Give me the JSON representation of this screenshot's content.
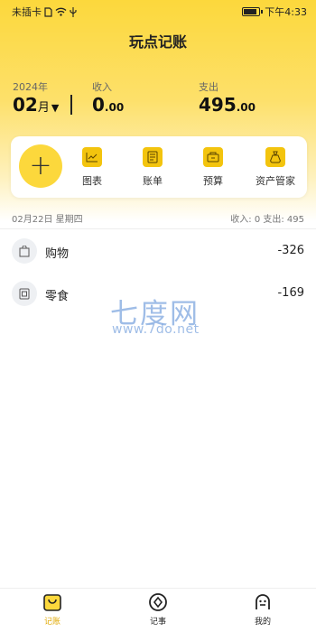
{
  "status_bar": {
    "carrier": "未插卡",
    "time": "下午4:33"
  },
  "app": {
    "title": "玩点记账"
  },
  "summary": {
    "year_label": "2024年",
    "month_num": "02",
    "month_suffix": "月",
    "income_label": "收入",
    "income_int": "0",
    "income_dec": ".00",
    "expense_label": "支出",
    "expense_int": "495",
    "expense_dec": ".00"
  },
  "actions": {
    "add_symbol": "+",
    "items": [
      {
        "label": "图表",
        "icon": "chart-icon"
      },
      {
        "label": "账单",
        "icon": "bill-icon"
      },
      {
        "label": "预算",
        "icon": "budget-icon"
      },
      {
        "label": "资产管家",
        "icon": "wallet-icon"
      }
    ]
  },
  "day": {
    "date": "02月22日 星期四",
    "totals": "收入:  0   支出:  495"
  },
  "records": [
    {
      "name": "购物",
      "amount": "-326",
      "icon": "shopping-bag-icon"
    },
    {
      "name": "零食",
      "amount": "-169",
      "icon": "snack-icon"
    }
  ],
  "watermark": {
    "line1": "七度网",
    "line2": "www.7do.net"
  },
  "nav": {
    "items": [
      {
        "label": "记账",
        "icon": "ledger-icon",
        "active": true
      },
      {
        "label": "记事",
        "icon": "notes-icon",
        "active": false
      },
      {
        "label": "我的",
        "icon": "profile-icon",
        "active": false
      }
    ]
  },
  "colors": {
    "accent": "#fcd83c",
    "icon_fill": "#f3c40e",
    "active_nav": "#e0a800"
  }
}
